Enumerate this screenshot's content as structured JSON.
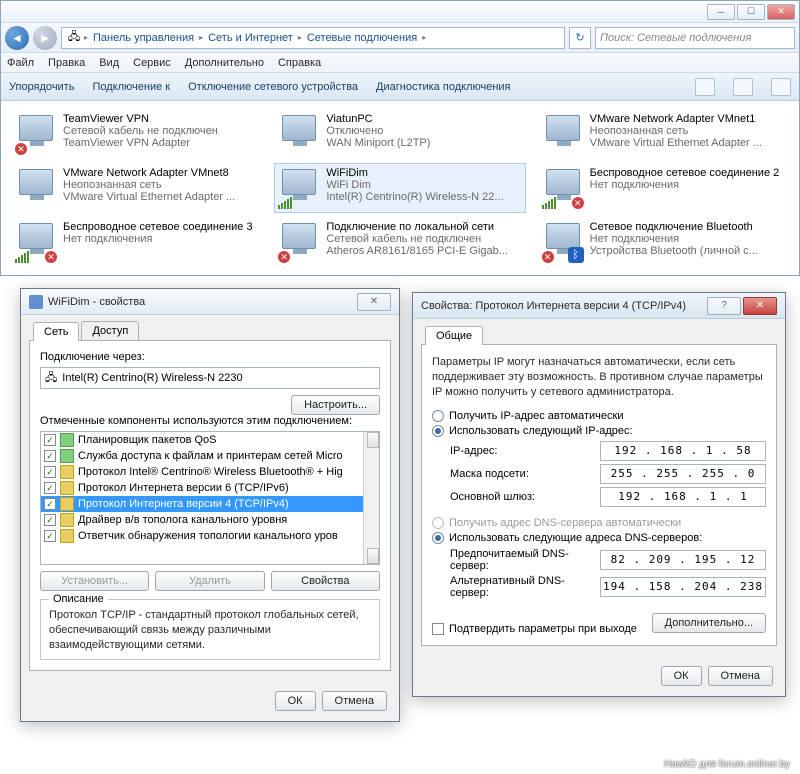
{
  "breadcrumb": {
    "seg1": "Панель управления",
    "seg2": "Сеть и Интернет",
    "seg3": "Сетевые подлючения"
  },
  "search": {
    "placeholder": "Поиск: Сетевые подлючения"
  },
  "menu": {
    "file": "Файл",
    "edit": "Правка",
    "view": "Вид",
    "service": "Сервис",
    "extra": "Дополнительно",
    "help": "Справка"
  },
  "toolbar": {
    "organize": "Упорядочить",
    "connect": "Подключение к",
    "disable": "Отключение сетевого устройства",
    "diagnose": "Диагностика подключения"
  },
  "connections": [
    {
      "name": "TeamViewer VPN",
      "status": "Сетевой кабель не подключен",
      "device": "TeamViewer VPN Adapter",
      "badge": "x"
    },
    {
      "name": "ViatunPC",
      "status": "Отключено",
      "device": "WAN Miniport (L2TP)",
      "badge": ""
    },
    {
      "name": "VMware Network Adapter VMnet1",
      "status": "Неопознанная сеть",
      "device": "VMware Virtual Ethernet Adapter ...",
      "badge": ""
    },
    {
      "name": "VMware Network Adapter VMnet8",
      "status": "Неопознанная сеть",
      "device": "VMware Virtual Ethernet Adapter ...",
      "badge": ""
    },
    {
      "name": "WiFiDim",
      "status": "WiFi Dim",
      "device": "Intel(R) Centrino(R) Wireless-N 22...",
      "badge": "bars",
      "selected": true
    },
    {
      "name": "Беспроводное сетевое соединение 2",
      "status": "Нет подключения",
      "device": "",
      "badge": "x-bars"
    },
    {
      "name": "Беспроводное сетевое соединение 3",
      "status": "Нет подключения",
      "device": "",
      "badge": "x-bars"
    },
    {
      "name": "Подключение по локальной сети",
      "status": "Сетевой кабель не подключен",
      "device": "Atheros AR8161/8165 PCI-E Gigab...",
      "badge": "x"
    },
    {
      "name": "Сетевое подключение Bluetooth",
      "status": "Нет подключения",
      "device": "Устройства Bluetooth (личной с...",
      "badge": "x-bt"
    }
  ],
  "props": {
    "title": "WiFiDim - свойства",
    "tab_net": "Сеть",
    "tab_access": "Доступ",
    "connect_via": "Подключение через:",
    "adapter": "Intel(R) Centrino(R) Wireless-N 2230",
    "configure": "Настроить...",
    "components_label": "Отмеченные компоненты используются этим подключением:",
    "components": [
      "Планировщик пакетов QoS",
      "Служба доступа к файлам и принтерам сетей Micro",
      "Протокол Intel® Centrino® Wireless Bluetooth® + Hig",
      "Протокол Интернета версии 6 (TCP/IPv6)",
      "Протокол Интернета версии 4 (TCP/IPv4)",
      "Драйвер в/в тополога канального уровня",
      "Ответчик обнаружения топологии канального уров"
    ],
    "install": "Установить...",
    "remove": "Удалить",
    "properties": "Свойства",
    "desc_title": "Описание",
    "desc": "Протокол TCP/IP - стандартный протокол глобальных сетей, обеспечивающий связь между различными взаимодействующими сетями.",
    "ok": "ОК",
    "cancel": "Отмена"
  },
  "ipv4": {
    "title": "Свойства: Протокол Интернета версии 4 (TCP/IPv4)",
    "tab_general": "Общие",
    "info": "Параметры IP могут назначаться автоматически, если сеть поддерживает эту возможность. В противном случае параметры IP можно получить у сетевого администратора.",
    "auto_ip": "Получить IP-адрес автоматически",
    "manual_ip": "Использовать следующий IP-адрес:",
    "ip_label": "IP-адрес:",
    "ip_val": "192 . 168 .  1  . 58",
    "mask_label": "Маска подсети:",
    "mask_val": "255 . 255 . 255 .  0",
    "gw_label": "Основной шлюз:",
    "gw_val": "192 . 168 .  1  .  1",
    "auto_dns": "Получить адрес DNS-сервера автоматически",
    "manual_dns": "Использовать следующие адреса DNS-серверов:",
    "dns1_label": "Предпочитаемый DNS-сервер:",
    "dns1_val": " 82 . 209 . 195 . 12",
    "dns2_label": "Альтернативный DNS-сервер:",
    "dns2_val": "194 . 158 . 204 . 238",
    "validate": "Подтвердить параметры при выходе",
    "advanced": "Дополнительно...",
    "ok": "ОК",
    "cancel": "Отмена"
  },
  "watermark": "HawkD для forum.onliner.by"
}
